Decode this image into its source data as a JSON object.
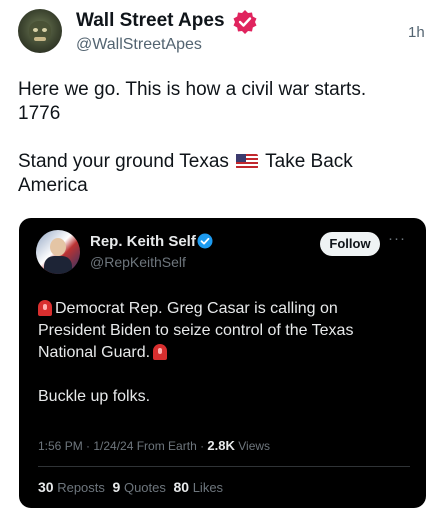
{
  "post": {
    "author_name": "Wall Street Apes",
    "author_handle": "@WallStreetApes",
    "time": "1h",
    "line1": "Here we go. This is how a civil war starts.",
    "line2": "1776",
    "line3a": "Stand your ground Texas",
    "line3b": "Take Back",
    "line4": "America",
    "flag_icon": "us-flag-icon",
    "verified_color": "#e0245e"
  },
  "quote": {
    "author_name": "Rep. Keith Self",
    "author_handle": "@RepKeithSelf",
    "follow_label": "Follow",
    "more_label": "···",
    "text_line1": "Democrat Rep. Greg Casar is calling on",
    "text_line2": "President Biden to seize control of the Texas",
    "text_line3": "National Guard.",
    "text_line4": "Buckle up folks.",
    "timestamp": "1:56 PM · 1/24/24 From Earth ·",
    "views_count": "2.8K",
    "views_label": "Views",
    "reposts_count": "30",
    "reposts_label": "Reposts",
    "quotes_count": "9",
    "quotes_label": "Quotes",
    "likes_count": "80",
    "likes_label": "Likes",
    "verified_color": "#1d9bf0",
    "siren_icon": "siren-icon"
  }
}
